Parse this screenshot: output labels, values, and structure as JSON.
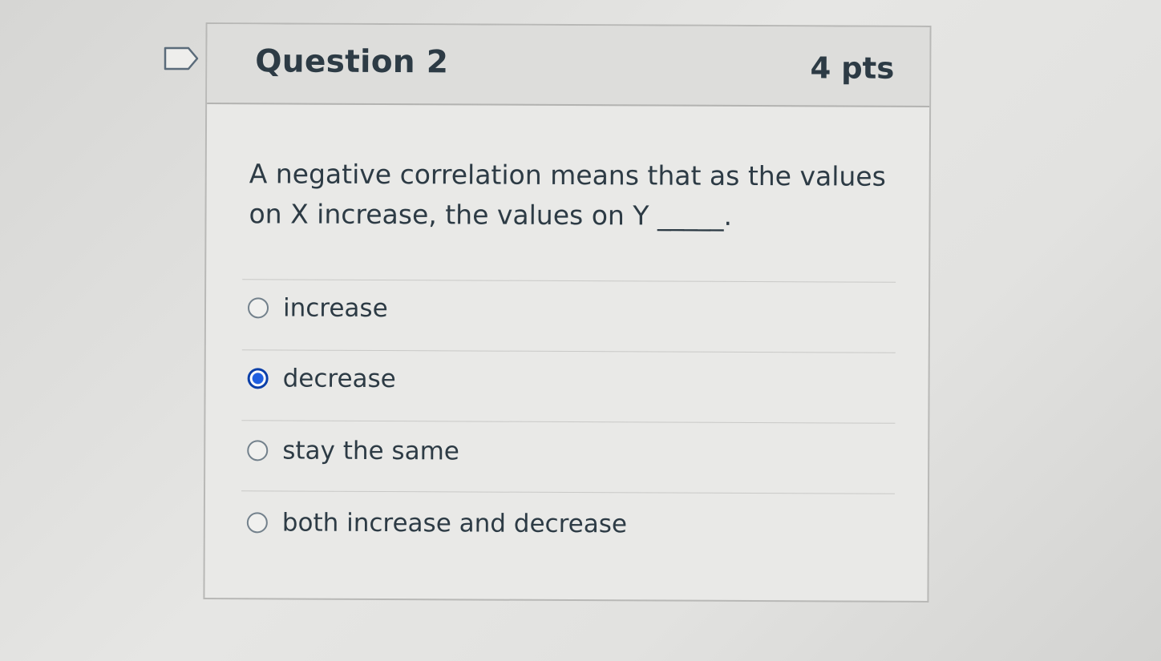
{
  "question": {
    "title": "Question 2",
    "points": "4 pts",
    "text_line1": "A negative correlation means that as the values",
    "text_line2": "on X increase, the values on Y _____."
  },
  "answers": [
    {
      "label": "increase",
      "selected": false
    },
    {
      "label": "decrease",
      "selected": true
    },
    {
      "label": "stay the same",
      "selected": false
    },
    {
      "label": "both increase and decrease",
      "selected": false
    }
  ],
  "colors": {
    "selected_radio": "#1f5fe0",
    "text": "#2d3b45"
  },
  "icons": {
    "flag": "flag-icon"
  }
}
